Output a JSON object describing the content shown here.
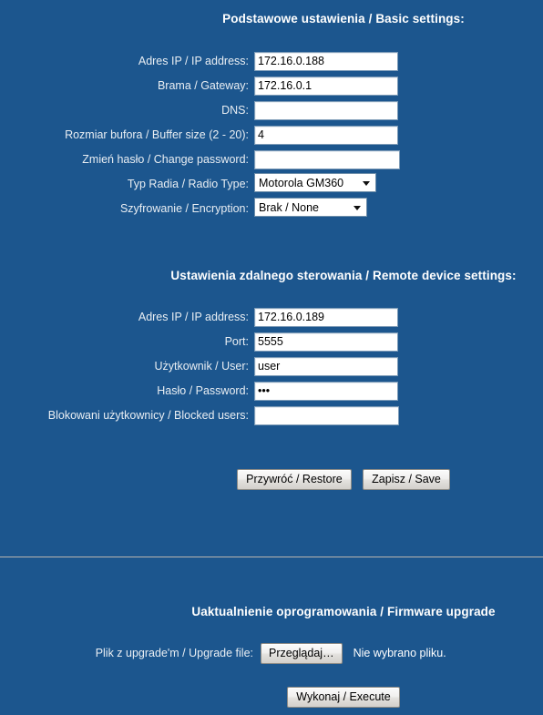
{
  "colors": {
    "background": "#1c568e",
    "label_text": "#e9eef3",
    "heading_text": "#ffffff",
    "input_background": "#ffffff",
    "input_text": "#000000",
    "divider": "#b9b6af",
    "button_face": "#e9e7e3"
  },
  "basic_section": {
    "heading": "Podstawowe ustawienia / Basic settings:",
    "fields": [
      {
        "label": "Adres IP / IP address:",
        "value": "172.16.0.188",
        "placeholder": "",
        "type": "text",
        "name": "basic-ip-address"
      },
      {
        "label": "Brama / Gateway:",
        "value": "172.16.0.1",
        "placeholder": "",
        "type": "text",
        "name": "basic-gateway"
      },
      {
        "label": "DNS:",
        "value": "",
        "placeholder": "",
        "type": "text",
        "name": "basic-dns"
      },
      {
        "label": "Rozmiar bufora / Buffer size (2 - 20):",
        "value": "4",
        "placeholder": "",
        "type": "text",
        "name": "basic-buffer-size"
      },
      {
        "label": "Zmień hasło / Change password:",
        "value": "",
        "placeholder": "",
        "type": "password",
        "name": "basic-change-password"
      }
    ],
    "radio_type": {
      "label": "Typ Radia / Radio Type:",
      "selected": "Motorola GM360",
      "options": [
        "Motorola GM360"
      ]
    },
    "encryption": {
      "label": "Szyfrowanie / Encryption:",
      "selected": "Brak / None",
      "options": [
        "Brak / None"
      ]
    }
  },
  "remote_section": {
    "heading": "Ustawienia zdalnego sterowania / Remote device settings:",
    "fields": [
      {
        "label": "Adres IP / IP address:",
        "value": "172.16.0.189",
        "placeholder": "",
        "type": "text",
        "name": "remote-ip-address"
      },
      {
        "label": "Port:",
        "value": "5555",
        "placeholder": "",
        "type": "text",
        "name": "remote-port"
      },
      {
        "label": "Użytkownik / User:",
        "value": "user",
        "placeholder": "",
        "type": "text",
        "name": "remote-user"
      },
      {
        "label": "Hasło / Password:",
        "value": "•••",
        "placeholder": "",
        "type": "password",
        "name": "remote-password"
      },
      {
        "label": "Blokowani użytkownicy / Blocked users:",
        "value": "",
        "placeholder": "",
        "type": "text",
        "name": "remote-blocked-users"
      }
    ]
  },
  "actions": {
    "restore_label": "Przywróć / Restore",
    "save_label": "Zapisz / Save"
  },
  "firmware_section": {
    "heading": "Uaktualnienie oprogramowania / Firmware upgrade",
    "file_label": "Plik z upgrade'm / Upgrade file:",
    "browse_label": "Przeglądaj…",
    "file_status": "Nie wybrano pliku.",
    "execute_label": "Wykonaj / Execute"
  }
}
